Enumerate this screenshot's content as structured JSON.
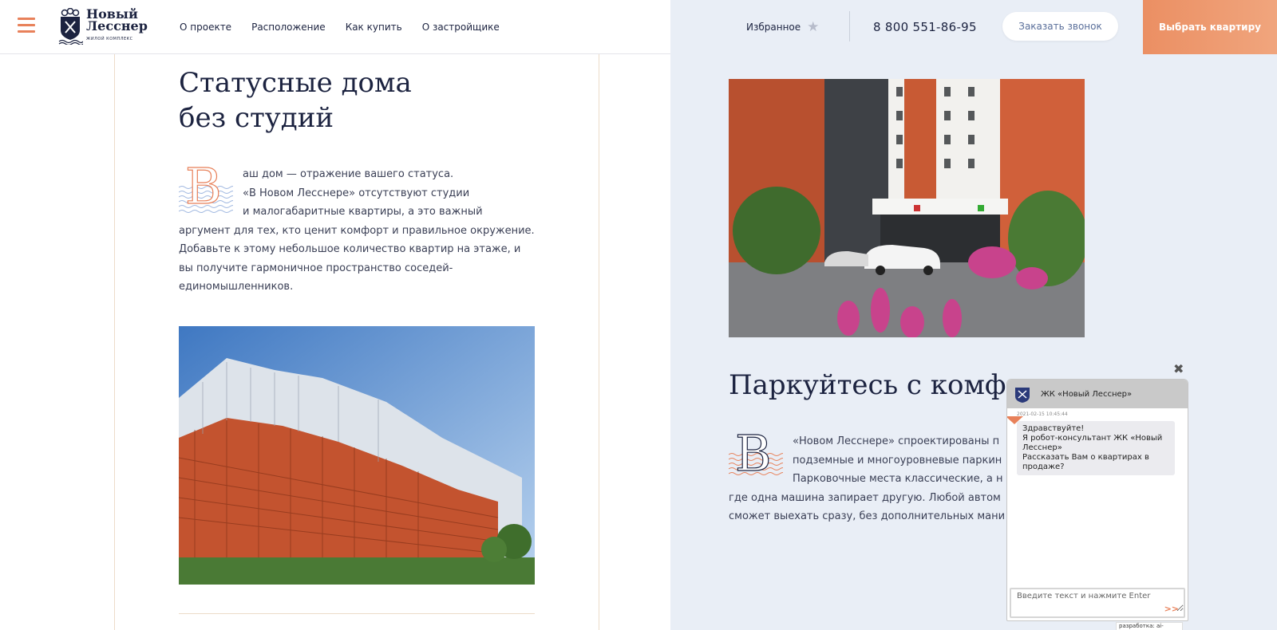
{
  "header": {
    "logo_line1": "Новый",
    "logo_line2": "Лесснер",
    "logo_sub": "ЖИЛОЙ КОМПЛЕКС",
    "nav": [
      "О проекте",
      "Расположение",
      "Как купить",
      "О застройщике"
    ],
    "favorites_label": "Избранное",
    "phone": "8 800 551-86-95",
    "callback_label": "Заказать звонок",
    "choose_label": "Выбрать квартиру"
  },
  "left": {
    "title_line1": "Статусные дома",
    "title_line2": "без студий",
    "dropcap": "В",
    "para_line1": "аш дом — отражение вашего статуса.",
    "para_line2": "«В Новом Лесснере» отсутствуют студии",
    "para_line3": "и малогабаритные квартиры, а это важный",
    "para_rest": "аргумент для тех, кто ценит комфорт и правильное окружение. Добавьте к этому небольшое количество квартир на этаже, и вы получите гармоничное пространство соседей-единомышленников."
  },
  "right": {
    "title": "Паркуйтесь с комфо",
    "dropcap": "В",
    "para_line1": " «Новом Лесснере» спроектированы п",
    "para_line2": "подземные и многоуровневые паркин",
    "para_line3": "Парковочные места классические, а н",
    "para_line4": "где одна машина запирает другую. Любой автом",
    "para_line5": "сможет выехать сразу, без дополнительных мани"
  },
  "chat": {
    "title": "ЖК «Новый Лесснер»",
    "time": "2021-02-15 10:45:44",
    "msg_line1": "Здравствуйте!",
    "msg_line2": "Я робот-консультант ЖК «Новый Лесснер»",
    "msg_line3": "Рассказать Вам о квартирах в продаже?",
    "input_placeholder": "Введите текст и нажмите Enter",
    "send": ">>",
    "close": "✖",
    "credit": "разработка: ai-chat.ru"
  },
  "colors": {
    "accent": "#e8815a",
    "navy": "#1c2340",
    "right_bg": "#e9eef6"
  }
}
